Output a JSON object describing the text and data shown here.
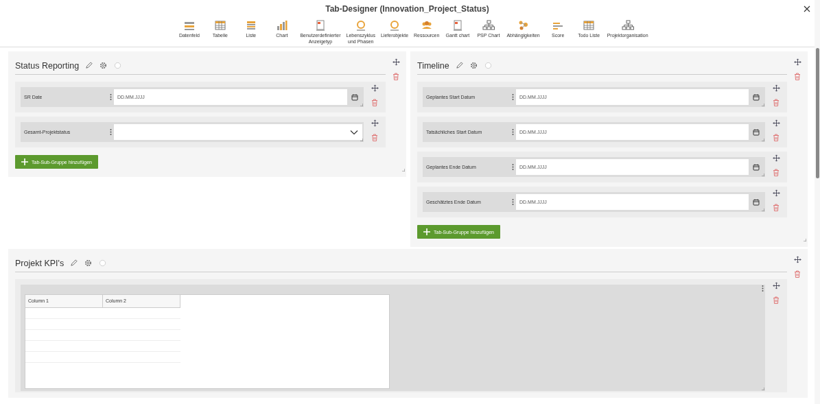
{
  "window": {
    "title": "Tab-Designer (Innovation_Project_Status)"
  },
  "toolbar": [
    {
      "kind": "datafield",
      "label": "Datenfeld"
    },
    {
      "kind": "table",
      "label": "Tabelle"
    },
    {
      "kind": "list",
      "label": "Liste"
    },
    {
      "kind": "chart",
      "label": "Chart"
    },
    {
      "kind": "doc",
      "label": "Benutzerdefinierter\nAnzeigetyp"
    },
    {
      "kind": "ring",
      "label": "Lebenszyklus\nund Phasen"
    },
    {
      "kind": "ring",
      "label": "Lieferobjekte"
    },
    {
      "kind": "people",
      "label": "Ressourcen"
    },
    {
      "kind": "doc",
      "label": "Gantt chart"
    },
    {
      "kind": "org",
      "label": "PSP Chart"
    },
    {
      "kind": "deps",
      "label": "Abhängigkeiten"
    },
    {
      "kind": "score",
      "label": "Score"
    },
    {
      "kind": "table",
      "label": "Todo Liste"
    },
    {
      "kind": "org",
      "label": "Projektorganisation"
    }
  ],
  "panels": [
    {
      "title": "Status Reporting",
      "groups": [
        {
          "kind": "date",
          "label": "SR Date",
          "placeholder": "DD.MM.JJJJ"
        },
        {
          "kind": "select",
          "label": "Gesamt-Projektstatus"
        }
      ],
      "add_button": "Tab-Sub-Gruppe hinzufügen"
    },
    {
      "title": "Timeline",
      "groups": [
        {
          "kind": "date",
          "label": "Geplantes Start Datum",
          "placeholder": "DD.MM.JJJJ"
        },
        {
          "kind": "date",
          "label": "Tatsächliches Start Datum",
          "placeholder": "DD.MM.JJJJ"
        },
        {
          "kind": "date",
          "label": "Geplantes Ende Datum",
          "placeholder": "DD.MM.JJJJ"
        },
        {
          "kind": "date",
          "label": "Geschätztes Ende Datum",
          "placeholder": "DD.MM.JJJJ"
        }
      ],
      "add_button": "Tab-Sub-Gruppe hinzufügen"
    },
    {
      "title": "Projekt KPI's",
      "groups": [
        {
          "kind": "table",
          "columns": [
            "Column 1",
            "Column 2"
          ]
        }
      ]
    }
  ]
}
